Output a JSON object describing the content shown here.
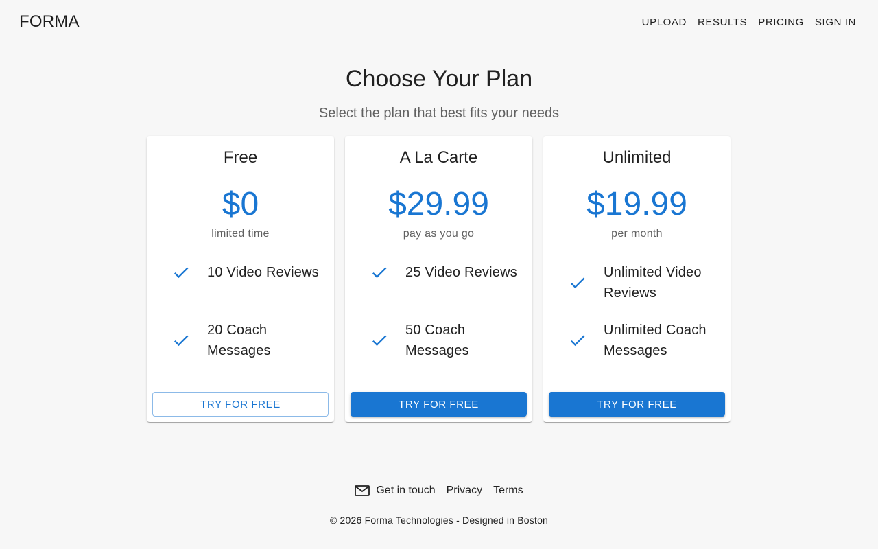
{
  "header": {
    "logo": "FORMA",
    "nav": {
      "upload": "UPLOAD",
      "results": "RESULTS",
      "pricing": "PRICING",
      "sign_in": "SIGN IN"
    }
  },
  "main": {
    "title": "Choose Your Plan",
    "subtitle": "Select the plan that best fits your needs"
  },
  "plans": [
    {
      "name": "Free",
      "price": "$0",
      "period": "limited time",
      "features": [
        "10 Video Reviews",
        "20 Coach Messages"
      ],
      "button_label": "TRY FOR FREE",
      "button_style": "outlined"
    },
    {
      "name": "A La Carte",
      "price": "$29.99",
      "period": "pay as you go",
      "features": [
        "25 Video Reviews",
        "50 Coach Messages"
      ],
      "button_label": "TRY FOR FREE",
      "button_style": "filled"
    },
    {
      "name": "Unlimited",
      "price": "$19.99",
      "period": "per month",
      "features": [
        "Unlimited Video Reviews",
        "Unlimited Coach Messages"
      ],
      "button_label": "TRY FOR FREE",
      "button_style": "filled"
    }
  ],
  "footer": {
    "contact_icon": "mail-icon",
    "contact": "Get in touch",
    "privacy": "Privacy",
    "terms": "Terms",
    "copyright": "© 2026 Forma Technologies - Designed in Boston"
  },
  "colors": {
    "accent": "#1976d2",
    "background": "#f7f7f7",
    "text": "#212121",
    "muted": "#616161"
  }
}
